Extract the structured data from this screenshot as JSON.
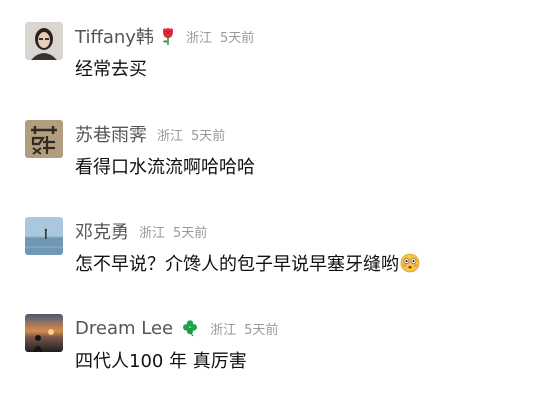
{
  "comments": [
    {
      "username": "Tiffany韩",
      "name_icon": "rose-icon",
      "location": "浙江",
      "time": "5天前",
      "text": "经常去买"
    },
    {
      "username": "苏巷雨霁",
      "location": "浙江",
      "time": "5天前",
      "text": "看得口水流流啊哈哈哈"
    },
    {
      "username": "邓克勇",
      "location": "浙江",
      "time": "5天前",
      "text": "怎不早说？介馋人的包子早说早塞牙缝哟",
      "trailing_emoji": "flushed-face-emoji"
    },
    {
      "username": "Dream Lee",
      "name_icon": "four-leaf-clover-icon",
      "location": "浙江",
      "time": "5天前",
      "text": "四代人100 年 真厉害"
    }
  ]
}
